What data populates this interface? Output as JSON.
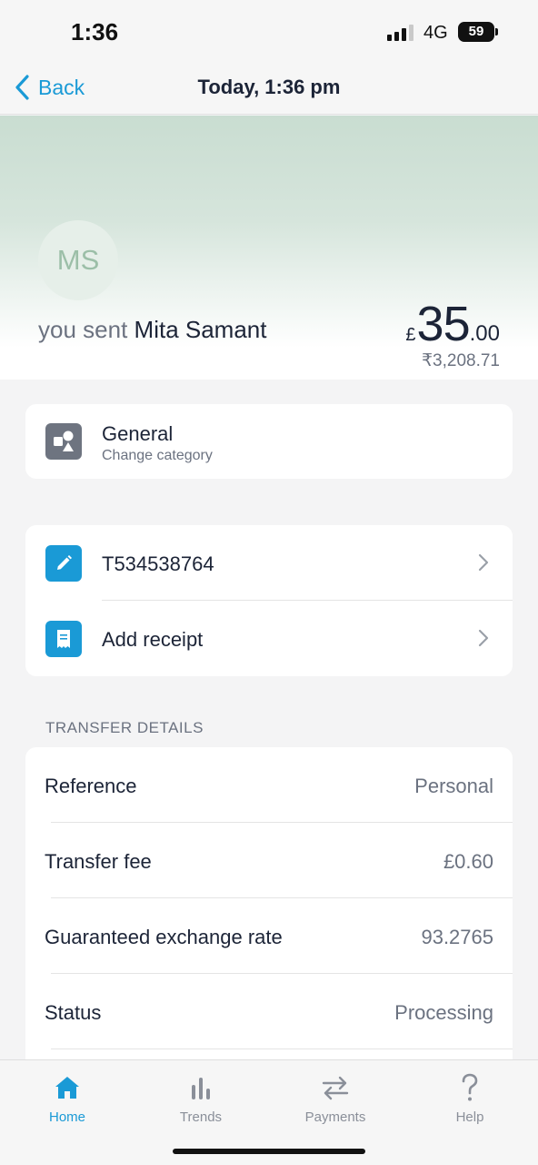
{
  "status_bar": {
    "time": "1:36",
    "network": "4G",
    "battery": "59"
  },
  "nav": {
    "back_label": "Back",
    "title": "Today, 1:36 pm"
  },
  "hero": {
    "avatar_initials": "MS",
    "sent_prefix": "you sent",
    "recipient": "Mita Samant",
    "amount_currency": "£",
    "amount_main": "35",
    "amount_decimal": ".00",
    "amount_local": "₹3,208.71"
  },
  "category": {
    "title": "General",
    "subtitle": "Change category"
  },
  "actions": [
    {
      "label": "T534538764",
      "icon": "pencil-icon"
    },
    {
      "label": "Add receipt",
      "icon": "receipt-icon"
    }
  ],
  "transfer_details": {
    "header": "TRANSFER DETAILS",
    "rows": [
      {
        "label": "Reference",
        "value": "Personal"
      },
      {
        "label": "Transfer fee",
        "value": "£0.60"
      },
      {
        "label": "Guaranteed exchange rate",
        "value": "93.2765"
      },
      {
        "label": "Status",
        "value": "Processing"
      }
    ]
  },
  "tabs": [
    {
      "label": "Home",
      "icon": "home-icon",
      "active": true
    },
    {
      "label": "Trends",
      "icon": "bar-chart-icon",
      "active": false
    },
    {
      "label": "Payments",
      "icon": "transfer-arrows-icon",
      "active": false
    },
    {
      "label": "Help",
      "icon": "question-icon",
      "active": false
    }
  ],
  "colors": {
    "accent": "#1a9ad6",
    "text": "#1c2437",
    "muted": "#6b7280",
    "hero_top": "#c9ddd1"
  }
}
